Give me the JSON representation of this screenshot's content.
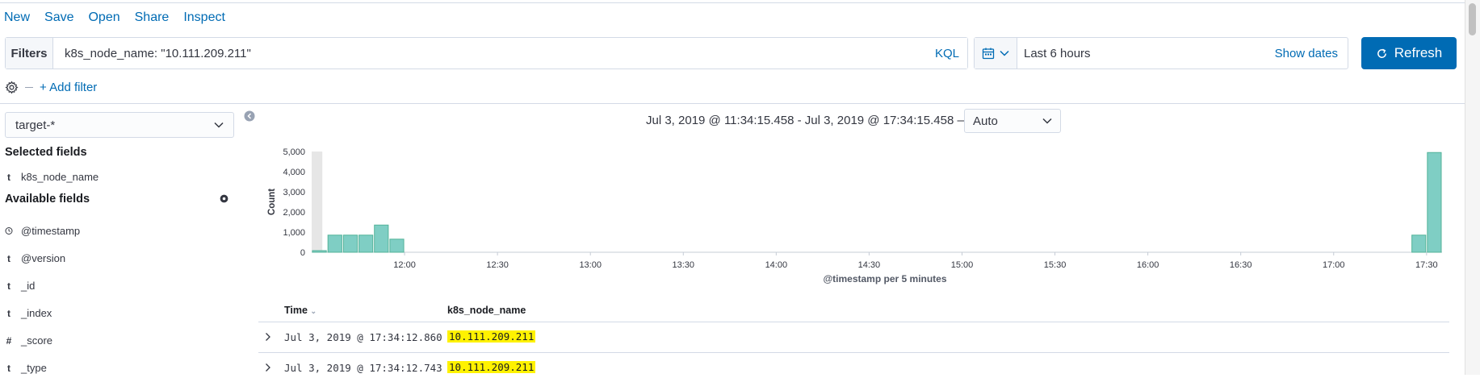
{
  "menu": {
    "new": "New",
    "save": "Save",
    "open": "Open",
    "share": "Share",
    "inspect": "Inspect"
  },
  "query": {
    "label": "Filters",
    "text": "k8s_node_name: \"10.111.209.211\"",
    "language": "KQL"
  },
  "datepicker": {
    "value": "Last 6 hours",
    "show_dates": "Show dates"
  },
  "refresh_label": "Refresh",
  "add_filter": "+ Add filter",
  "sidebar": {
    "index_pattern": "target-*",
    "selected_heading": "Selected fields",
    "selected": [
      {
        "type": "t",
        "name": "k8s_node_name"
      }
    ],
    "available_heading": "Available fields",
    "available": [
      {
        "type": "clock",
        "name": "@timestamp"
      },
      {
        "type": "t",
        "name": "@version"
      },
      {
        "type": "t",
        "name": "_id"
      },
      {
        "type": "t",
        "name": "_index"
      },
      {
        "type": "#",
        "name": "_score"
      },
      {
        "type": "t",
        "name": "_type"
      }
    ]
  },
  "time_range_text": "Jul 3, 2019 @ 11:34:15.458 - Jul 3, 2019 @ 17:34:15.458 —",
  "interval": "Auto",
  "chart_data": {
    "type": "bar",
    "ylabel": "Count",
    "xlabel": "@timestamp per 5 minutes",
    "ylim": [
      0,
      5000
    ],
    "yticks": [
      "0",
      "1,000",
      "2,000",
      "3,000",
      "4,000",
      "5,000"
    ],
    "xticks": [
      "12:00",
      "12:30",
      "13:00",
      "13:30",
      "14:00",
      "14:30",
      "15:00",
      "15:30",
      "16:00",
      "16:30",
      "17:00",
      "17:30"
    ],
    "x_start": "11:30",
    "x_end": "17:35",
    "bar_color": "#7fcec4",
    "bars": [
      {
        "t": "11:30",
        "value": 80
      },
      {
        "t": "11:35",
        "value": 850
      },
      {
        "t": "11:40",
        "value": 850
      },
      {
        "t": "11:45",
        "value": 850
      },
      {
        "t": "11:50",
        "value": 1350
      },
      {
        "t": "11:55",
        "value": 650
      },
      {
        "t": "17:25",
        "value": 850
      },
      {
        "t": "17:30",
        "value": 4950
      }
    ]
  },
  "table": {
    "col_time": "Time",
    "col_node": "k8s_node_name",
    "rows": [
      {
        "time": "Jul 3, 2019 @ 17:34:12.860",
        "node": "10.111.209.211"
      },
      {
        "time": "Jul 3, 2019 @ 17:34:12.743",
        "node": "10.111.209.211"
      }
    ]
  }
}
